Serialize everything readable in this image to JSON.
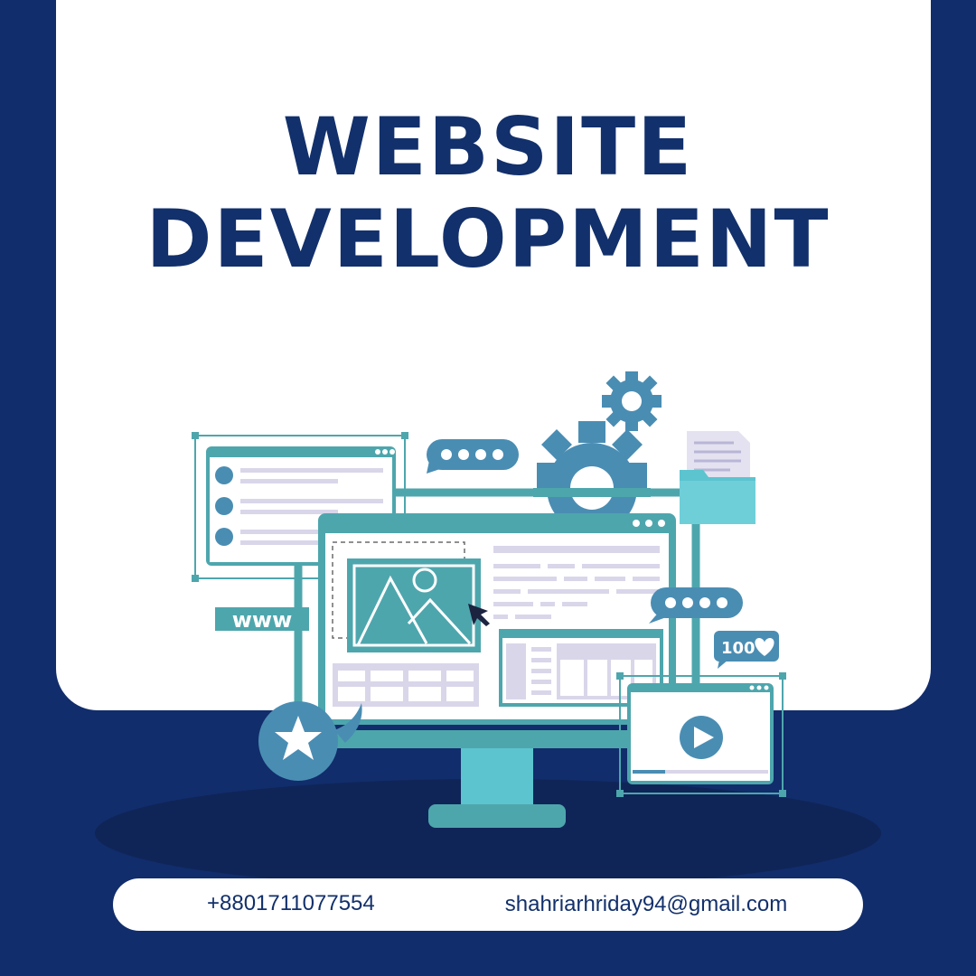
{
  "title": {
    "line1": "WEBSITE",
    "line2": "DEVELOPMENT"
  },
  "illustration": {
    "www_label": "www",
    "likes_label": "100",
    "icons": [
      "gear-icon",
      "chat-bubble-icon",
      "folder-icon",
      "document-icon",
      "image-icon",
      "cursor-icon",
      "star-icon",
      "play-icon",
      "heart-icon"
    ]
  },
  "contact": {
    "phone": "+8801711077554",
    "email": "shahriarhriday94@gmail.com"
  },
  "colors": {
    "background": "#112d6b",
    "card": "#ffffff",
    "title": "#12306b",
    "teal": "#4ea6ad",
    "light_teal": "#5bc4cf",
    "blue_accent": "#4a8db3",
    "lavender": "#d9d6ea"
  }
}
